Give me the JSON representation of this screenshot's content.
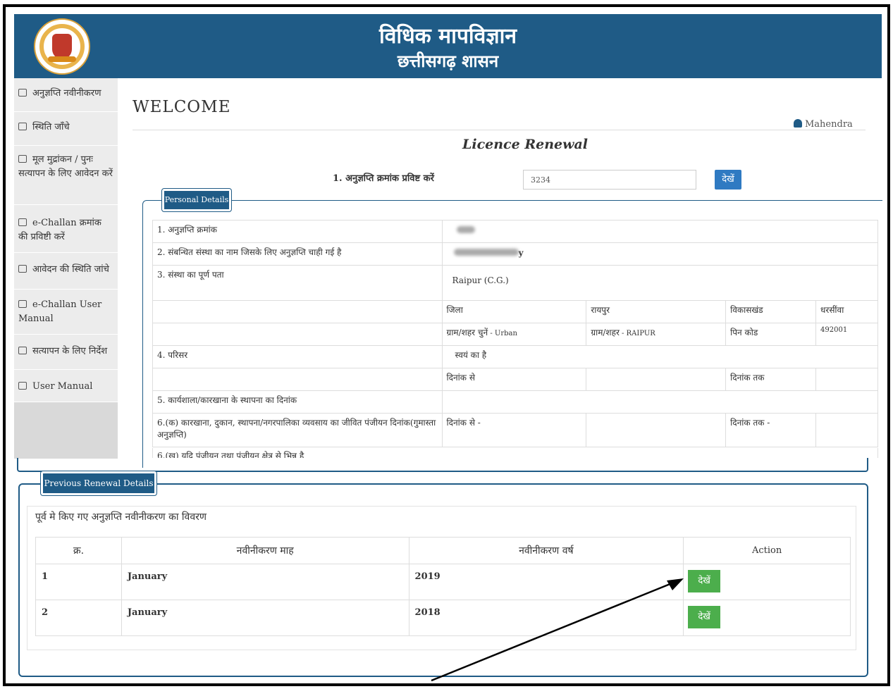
{
  "header": {
    "title": "विधिक मापविज्ञान",
    "subtitle": "छत्तीसगढ़ शासन"
  },
  "sidebar": {
    "items": [
      {
        "label": "अनुज्ञप्ति नवीनीकरण"
      },
      {
        "label": "स्थिति जाँचे"
      },
      {
        "label": "मूल मुद्रांकन / पुनः सत्यापन के लिए आवेदन करें"
      },
      {
        "label": "e-Challan क्रमांक की प्रविष्टी करें"
      },
      {
        "label": "आवेदन की स्थिति जांचे"
      },
      {
        "label": "e-Challan User Manual"
      },
      {
        "label": "सत्यापन के लिए निर्देश"
      },
      {
        "label": "User Manual"
      }
    ]
  },
  "main": {
    "welcome": "WELCOME",
    "user_name": "Mahendra",
    "page_title": "Licence Renewal",
    "licence_label": "1. अनुज्ञप्ति क्रमांक प्रविष्ट करें",
    "licence_value": "3234",
    "view_button": "देखें"
  },
  "personal_details": {
    "legend": "Personal Details",
    "row1_label": "1. अनुज्ञप्ति क्रमांक",
    "row2_label": "2. संबन्धित संस्था का नाम जिसके लिए अनुज्ञप्ति चाही गई है",
    "row2_value_tail": "y",
    "row3_label": "3. संस्था का पूर्ण पता",
    "row3_value": "Raipur (C.G.)",
    "district_label": "जिला",
    "district_value": "रायपुर",
    "block_label": "विकासखंड",
    "block_value": "धरसींवा",
    "village_label": "ग्राम/शहर चुनें",
    "village_value": " - Urban",
    "city_label": "ग्राम/शहर",
    "city_value": " - RAIPUR",
    "pin_label": "पिन कोड",
    "pin_value": "492001",
    "row4_label": "4. परिसर",
    "row4_value": "स्वयं का है",
    "from_date_label": "दिनांक से",
    "to_date_label": "दिनांक तक",
    "row5_label": "5. कार्यशाला/कारखाना के स्थापना का दिनांक",
    "row6_label": "6.(क) कारखाना, दुकान, स्थापना/नगरपालिका व्यवसाय का जीवित पंजीयन दिनांक(गुमास्ता अनुज्ञप्ति)",
    "row6_from": "दिनांक से -",
    "row6_to": "दिनांक तक -",
    "row6b_label": "6.(ख) यदि पंजीयन तथा पंजीयन क्षेत्र से भिन्न है"
  },
  "previous_renewal": {
    "legend": "Previous Renewal Details",
    "heading": "पूर्व मे किए गए अनुज्ञप्ति नवीनीकरण का विवरण",
    "columns": [
      "क्र.",
      "नवीनीकरण माह",
      "नवीनीकरण वर्ष",
      "Action"
    ],
    "rows": [
      {
        "sno": "1",
        "month": "January",
        "year": "2019",
        "action": "देखें"
      },
      {
        "sno": "2",
        "month": "January",
        "year": "2018",
        "action": "देखें"
      }
    ]
  },
  "colors": {
    "header_bg": "#1f5b86",
    "view_button": "#2f7ac2",
    "action_button": "#4cae4c"
  }
}
